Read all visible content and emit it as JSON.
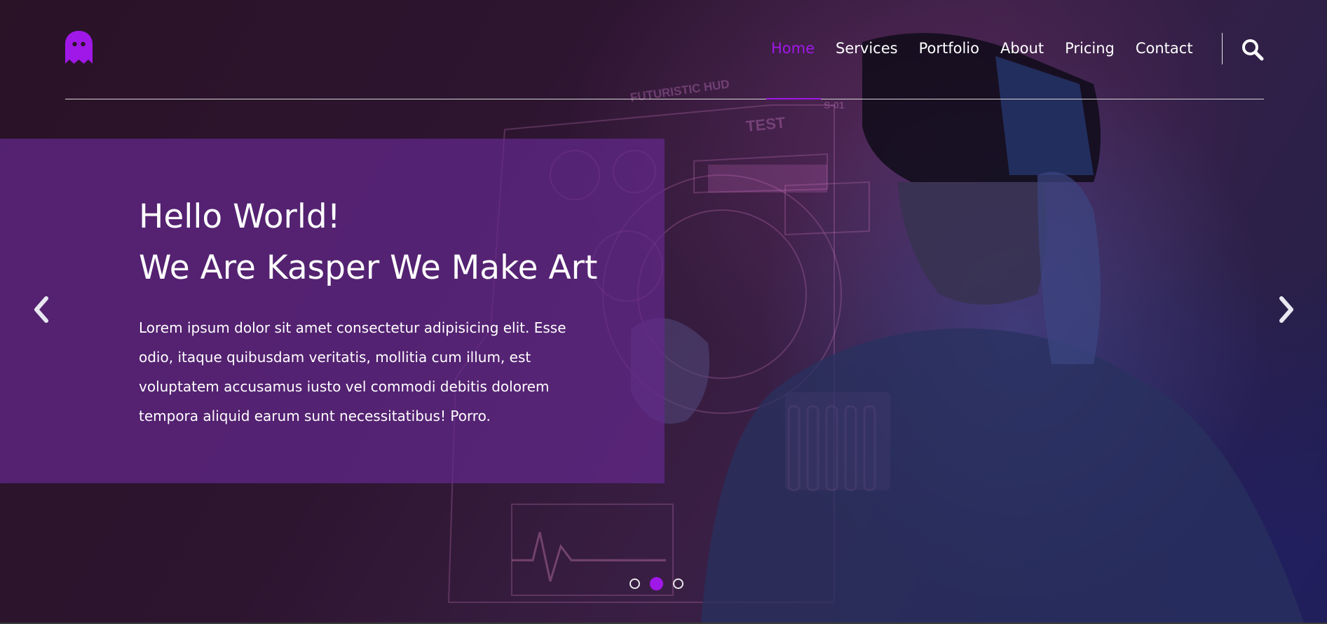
{
  "colors": {
    "accent": "#a018e8",
    "panel": "#64288c",
    "text": "#ffffff"
  },
  "header": {
    "logo_icon": "ghost-icon",
    "nav": [
      {
        "label": "Home",
        "active": true
      },
      {
        "label": "Services",
        "active": false
      },
      {
        "label": "Portfolio",
        "active": false
      },
      {
        "label": "About",
        "active": false
      },
      {
        "label": "Pricing",
        "active": false
      },
      {
        "label": "Contact",
        "active": false
      }
    ],
    "search_icon": "search-icon"
  },
  "hero": {
    "title_line1": "Hello World!",
    "title_line2": "We Are Kasper We Make Art",
    "description": "Lorem ipsum dolor sit amet consectetur adipisicing elit. Esse odio, itaque quibusdam veritatis, mollitia cum illum, est voluptatem accusamus iusto vel commodi debitis dolorem tempora aliquid earum sunt necessitatibus! Porro.",
    "prev_icon": "chevron-left-icon",
    "next_icon": "chevron-right-icon",
    "hud_labels": {
      "top": "FUTURISTIC HUD",
      "test": "TEST",
      "code": "S-01"
    },
    "bullets": [
      {
        "active": false
      },
      {
        "active": true
      },
      {
        "active": false
      }
    ]
  }
}
